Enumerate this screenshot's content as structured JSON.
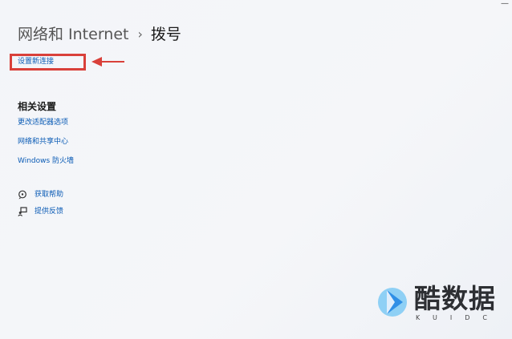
{
  "window": {
    "close_glyph": "—"
  },
  "header": {
    "parent": "网络和 Internet",
    "separator": "›",
    "current": "拨号"
  },
  "actions": {
    "setup_new_connection": "设置新连接"
  },
  "related_settings": {
    "title": "相关设置",
    "links": [
      "更改适配器选项",
      "网络和共享中心",
      "Windows 防火墙"
    ]
  },
  "help": {
    "get_help": {
      "label": "获取帮助",
      "icon": "help-chat-icon"
    },
    "feedback": {
      "label": "提供反馈",
      "icon": "feedback-icon"
    }
  },
  "watermark": {
    "title": "酷数据",
    "subtitle": "KUIDC"
  },
  "colors": {
    "link": "#0a5bb5",
    "annotation": "#d9403a",
    "logo_blue": "#2f8fe6",
    "logo_light": "#8fd0f5"
  }
}
